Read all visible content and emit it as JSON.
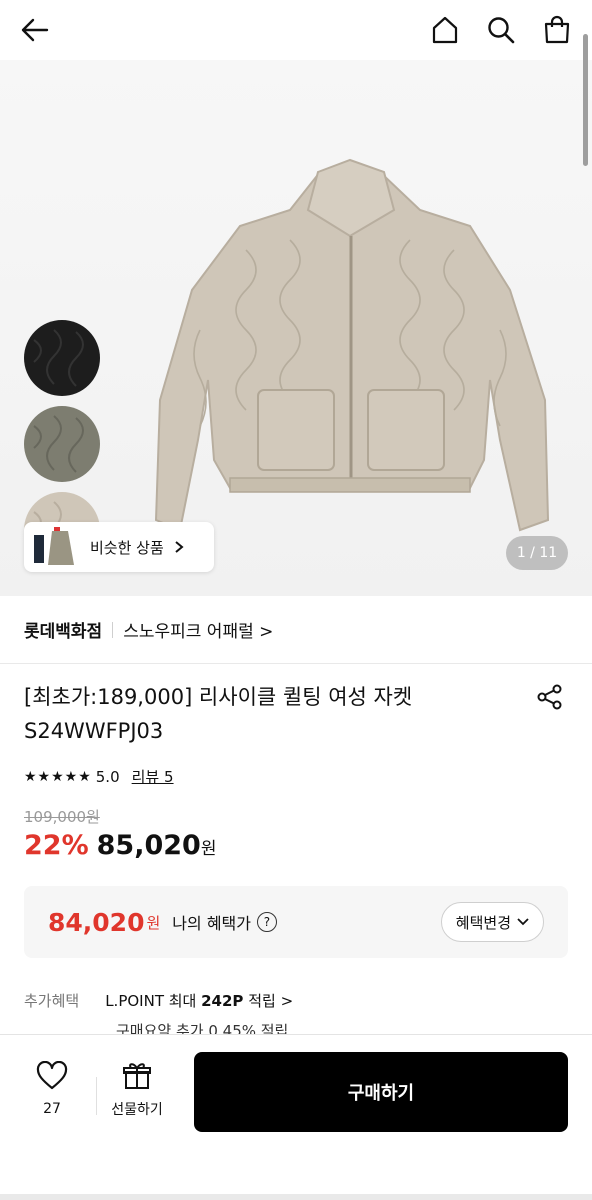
{
  "hero": {
    "counter": "1 / 11",
    "similar_label": "비슷한 상품",
    "swatches": [
      "black-jacket-swatch",
      "khaki-jacket-swatch",
      "beige-jacket-swatch"
    ]
  },
  "brand": {
    "store": "롯데백화점",
    "name": "스노우피크 어패럴 >"
  },
  "product": {
    "title_line1": "[최초가:189,000] 리사이클 퀼팅 여성 자켓",
    "title_line2": "S24WWFPJ03",
    "stars": "★★★★★",
    "rating": "5.0",
    "reviews": "리뷰 5",
    "original_price": "109,000원",
    "discount": "22%",
    "price": "85,020",
    "currency": "원"
  },
  "benefit": {
    "price": "84,020",
    "currency": "원",
    "label": "나의 혜택가",
    "help": "?",
    "change_button": "혜택변경"
  },
  "extra": {
    "key": "추가혜택",
    "point_prefix": "L.POINT 최대 ",
    "point_value": "242P",
    "point_suffix": " 적립 >",
    "line2": "구매요약 추가 0.45% 적립"
  },
  "bottom_bar": {
    "likes": "27",
    "gift_label": "선물하기",
    "buy_label": "구매하기"
  },
  "colors": {
    "accent_red": "#e0362c",
    "buy_button": "#000000"
  }
}
